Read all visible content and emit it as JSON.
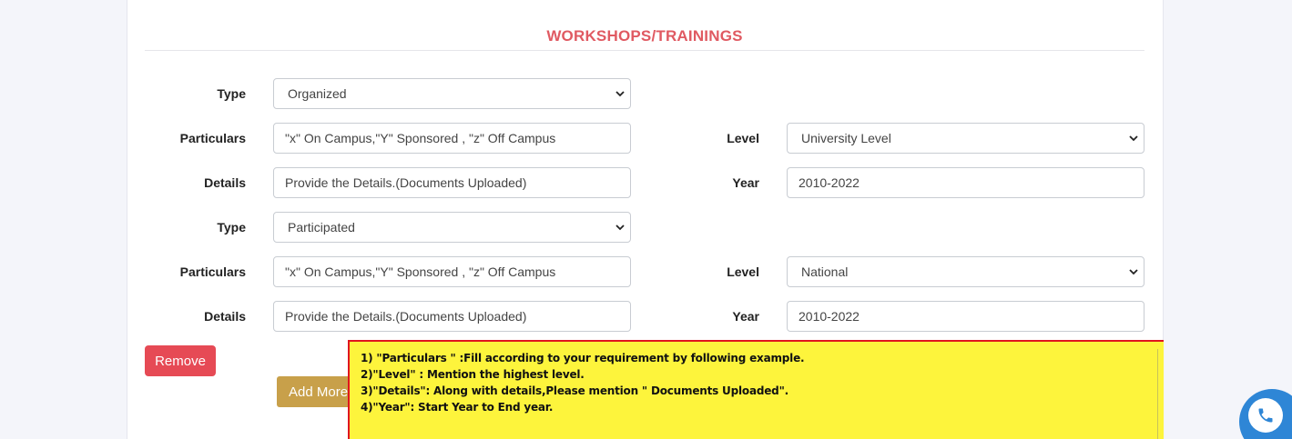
{
  "section": {
    "title": "WORKSHOPS/TRAININGS"
  },
  "entries": [
    {
      "type_label": "Type",
      "type_value": "Organized",
      "particulars_label": "Particulars",
      "particulars_value": "\"x\" On Campus,\"Y\" Sponsored , \"z\" Off Campus",
      "level_label": "Level",
      "level_value": "University Level",
      "details_label": "Details",
      "details_value": "Provide the Details.(Documents Uploaded)",
      "year_label": "Year",
      "year_value": "2010-2022"
    },
    {
      "type_label": "Type",
      "type_value": "Participated",
      "particulars_label": "Particulars",
      "particulars_value": "\"x\" On Campus,\"Y\" Sponsored , \"z\" Off Campus",
      "level_label": "Level",
      "level_value": "National",
      "details_label": "Details",
      "details_value": "Provide the Details.(Documents Uploaded)",
      "year_label": "Year",
      "year_value": "2010-2022"
    }
  ],
  "buttons": {
    "remove": "Remove",
    "add_more": "Add More"
  },
  "instructions": [
    "1) \"Particulars \" :Fill according to your requirement by following example.",
    "2)\"Level\" : Mention the highest level.",
    "3)\"Details\": Along with details,Please mention \" Documents Uploaded\".",
    "4)\"Year\": Start Year to End year."
  ],
  "colors": {
    "title": "#e05a62",
    "remove": "#e64a55",
    "add_more": "#c8a04a",
    "note_bg": "#fdf43c",
    "note_border": "#e0141e",
    "call": "#2e86d6"
  },
  "icons": {
    "select_arrow": "chevron-down-icon",
    "call": "phone-icon"
  }
}
